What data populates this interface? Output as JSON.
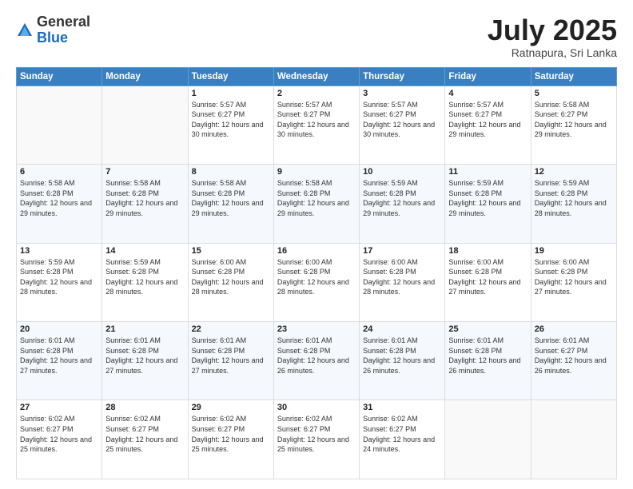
{
  "logo": {
    "general": "General",
    "blue": "Blue"
  },
  "header": {
    "month": "July 2025",
    "location": "Ratnapura, Sri Lanka"
  },
  "days_of_week": [
    "Sunday",
    "Monday",
    "Tuesday",
    "Wednesday",
    "Thursday",
    "Friday",
    "Saturday"
  ],
  "weeks": [
    [
      {
        "day": "",
        "info": ""
      },
      {
        "day": "",
        "info": ""
      },
      {
        "day": "1",
        "info": "Sunrise: 5:57 AM\nSunset: 6:27 PM\nDaylight: 12 hours and 30 minutes."
      },
      {
        "day": "2",
        "info": "Sunrise: 5:57 AM\nSunset: 6:27 PM\nDaylight: 12 hours and 30 minutes."
      },
      {
        "day": "3",
        "info": "Sunrise: 5:57 AM\nSunset: 6:27 PM\nDaylight: 12 hours and 30 minutes."
      },
      {
        "day": "4",
        "info": "Sunrise: 5:57 AM\nSunset: 6:27 PM\nDaylight: 12 hours and 29 minutes."
      },
      {
        "day": "5",
        "info": "Sunrise: 5:58 AM\nSunset: 6:27 PM\nDaylight: 12 hours and 29 minutes."
      }
    ],
    [
      {
        "day": "6",
        "info": "Sunrise: 5:58 AM\nSunset: 6:28 PM\nDaylight: 12 hours and 29 minutes."
      },
      {
        "day": "7",
        "info": "Sunrise: 5:58 AM\nSunset: 6:28 PM\nDaylight: 12 hours and 29 minutes."
      },
      {
        "day": "8",
        "info": "Sunrise: 5:58 AM\nSunset: 6:28 PM\nDaylight: 12 hours and 29 minutes."
      },
      {
        "day": "9",
        "info": "Sunrise: 5:58 AM\nSunset: 6:28 PM\nDaylight: 12 hours and 29 minutes."
      },
      {
        "day": "10",
        "info": "Sunrise: 5:59 AM\nSunset: 6:28 PM\nDaylight: 12 hours and 29 minutes."
      },
      {
        "day": "11",
        "info": "Sunrise: 5:59 AM\nSunset: 6:28 PM\nDaylight: 12 hours and 29 minutes."
      },
      {
        "day": "12",
        "info": "Sunrise: 5:59 AM\nSunset: 6:28 PM\nDaylight: 12 hours and 28 minutes."
      }
    ],
    [
      {
        "day": "13",
        "info": "Sunrise: 5:59 AM\nSunset: 6:28 PM\nDaylight: 12 hours and 28 minutes."
      },
      {
        "day": "14",
        "info": "Sunrise: 5:59 AM\nSunset: 6:28 PM\nDaylight: 12 hours and 28 minutes."
      },
      {
        "day": "15",
        "info": "Sunrise: 6:00 AM\nSunset: 6:28 PM\nDaylight: 12 hours and 28 minutes."
      },
      {
        "day": "16",
        "info": "Sunrise: 6:00 AM\nSunset: 6:28 PM\nDaylight: 12 hours and 28 minutes."
      },
      {
        "day": "17",
        "info": "Sunrise: 6:00 AM\nSunset: 6:28 PM\nDaylight: 12 hours and 28 minutes."
      },
      {
        "day": "18",
        "info": "Sunrise: 6:00 AM\nSunset: 6:28 PM\nDaylight: 12 hours and 27 minutes."
      },
      {
        "day": "19",
        "info": "Sunrise: 6:00 AM\nSunset: 6:28 PM\nDaylight: 12 hours and 27 minutes."
      }
    ],
    [
      {
        "day": "20",
        "info": "Sunrise: 6:01 AM\nSunset: 6:28 PM\nDaylight: 12 hours and 27 minutes."
      },
      {
        "day": "21",
        "info": "Sunrise: 6:01 AM\nSunset: 6:28 PM\nDaylight: 12 hours and 27 minutes."
      },
      {
        "day": "22",
        "info": "Sunrise: 6:01 AM\nSunset: 6:28 PM\nDaylight: 12 hours and 27 minutes."
      },
      {
        "day": "23",
        "info": "Sunrise: 6:01 AM\nSunset: 6:28 PM\nDaylight: 12 hours and 26 minutes."
      },
      {
        "day": "24",
        "info": "Sunrise: 6:01 AM\nSunset: 6:28 PM\nDaylight: 12 hours and 26 minutes."
      },
      {
        "day": "25",
        "info": "Sunrise: 6:01 AM\nSunset: 6:28 PM\nDaylight: 12 hours and 26 minutes."
      },
      {
        "day": "26",
        "info": "Sunrise: 6:01 AM\nSunset: 6:27 PM\nDaylight: 12 hours and 26 minutes."
      }
    ],
    [
      {
        "day": "27",
        "info": "Sunrise: 6:02 AM\nSunset: 6:27 PM\nDaylight: 12 hours and 25 minutes."
      },
      {
        "day": "28",
        "info": "Sunrise: 6:02 AM\nSunset: 6:27 PM\nDaylight: 12 hours and 25 minutes."
      },
      {
        "day": "29",
        "info": "Sunrise: 6:02 AM\nSunset: 6:27 PM\nDaylight: 12 hours and 25 minutes."
      },
      {
        "day": "30",
        "info": "Sunrise: 6:02 AM\nSunset: 6:27 PM\nDaylight: 12 hours and 25 minutes."
      },
      {
        "day": "31",
        "info": "Sunrise: 6:02 AM\nSunset: 6:27 PM\nDaylight: 12 hours and 24 minutes."
      },
      {
        "day": "",
        "info": ""
      },
      {
        "day": "",
        "info": ""
      }
    ]
  ]
}
